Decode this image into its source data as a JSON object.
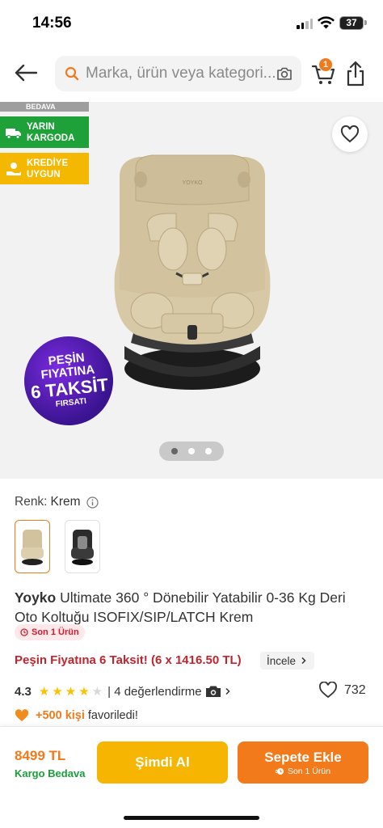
{
  "status_bar": {
    "time": "14:56",
    "battery": "37"
  },
  "header": {
    "search_placeholder": "Marka, ürün veya kategori...",
    "cart_count": "1"
  },
  "gallery": {
    "ribbon_top": "BEDAVA",
    "ribbon_cargo": "YARIN KARGODA",
    "ribbon_credit": "KREDİYE UYGUN",
    "promo": {
      "line1": "PEŞİN",
      "line2": "FIYATINA",
      "line3": "6 TAKSİT",
      "line4": "FIRSATI"
    },
    "page_count": 3,
    "active_page": 1
  },
  "color": {
    "label": "Renk:",
    "value": "Krem"
  },
  "product": {
    "brand": "Yoyko",
    "title": "Ultimate 360 ° Dönebilir Yatabilir 0-36 Kg Deri Oto Koltuğu ISOFIX/SIP/LATCH Krem",
    "tag": "Son 1 Ürün"
  },
  "installment": {
    "text": "Peşin Fiyatına 6 Taksit! (6 x 1416.50 TL)",
    "link": "İncele"
  },
  "rating": {
    "value": "4.3",
    "stars": 4.3,
    "reviews": "| 4 değerlendirme",
    "favorites": "732"
  },
  "favorited": {
    "count": "+500 kişi",
    "text": "favoriledi!"
  },
  "bottom": {
    "price": "8499 TL",
    "cargo": "Kargo Bedava",
    "buy_now": "Şimdi Al",
    "add_to_cart": "Sepete Ekle",
    "add_to_cart_sub": "Son 1 Ürün"
  },
  "colors": {
    "accent": "#f27a1a",
    "buy_now": "#f5b500",
    "cargo_green": "#1fa13a",
    "installment_red": "#c0252f"
  }
}
